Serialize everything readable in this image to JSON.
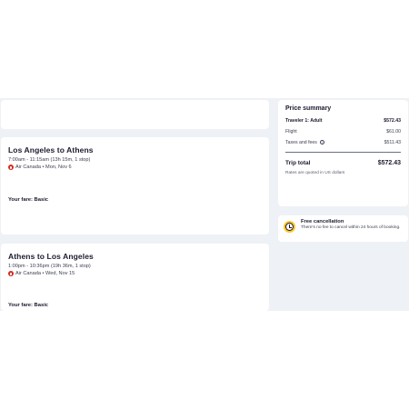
{
  "flights": [
    {
      "title": "Los Angeles to Athens",
      "time": "7:00am - 11:15am (13h 15m, 1 stop)",
      "airline": "Air Canada • Mon, Nov 6",
      "fare": "Your fare: Basic"
    },
    {
      "title": "Athens to Los Angeles",
      "time": "1:00pm - 10:36pm (19h 36m, 1 stop)",
      "airline": "Air Canada • Wed, Nov 15",
      "fare": "Your fare: Basic"
    }
  ],
  "price_summary": {
    "title": "Price summary",
    "traveler_label": "Traveler 1: Adult",
    "traveler_value": "$572.43",
    "flight_label": "Flight",
    "flight_value": "$61.00",
    "taxes_label": "Taxes and fees",
    "taxes_value": "$511.43",
    "total_label": "Trip total",
    "total_value": "$572.43",
    "note": "Rates are quoted in US dollars"
  },
  "cancellation": {
    "title": "Free cancellation",
    "description": "There's no fee to cancel within 24 hours of booking."
  },
  "icons": {
    "airline_logo": "air-canada-maple-leaf",
    "info": "info-circle",
    "clock": "clock"
  },
  "colors": {
    "page_background": "#eef1f5",
    "brand_red": "#d52b1e",
    "clock_yellow": "#ffc72c"
  }
}
